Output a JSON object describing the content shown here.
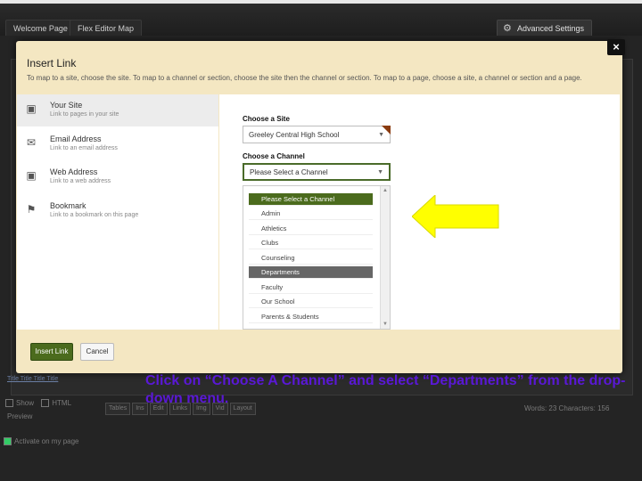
{
  "header": {
    "tabs": [
      "Welcome Page",
      "Flex Editor Map"
    ],
    "advanced_settings": "Advanced Settings"
  },
  "background_page": {
    "link_text": "Title Title Title Title",
    "toolbar": [
      "Tables",
      "Ins",
      "Edit",
      "Links",
      "Img",
      "Vid",
      "Layout"
    ],
    "checkbox1": "Show",
    "checkbox1b": "HTML",
    "preview": "Preview",
    "counter": "Words: 23 Characters: 156",
    "activate": "Activate on my page"
  },
  "dialog": {
    "title": "Insert Link",
    "instructions": "To map to a site, choose the site. To map to a channel or section, choose the site then the channel or section. To map to a page, choose a site, a channel or section and a page.",
    "close": "×",
    "options": [
      {
        "title": "Your Site",
        "desc": "Link to pages in your site"
      },
      {
        "title": "Email Address",
        "desc": "Link to an email address"
      },
      {
        "title": "Web Address",
        "desc": "Link to a web address"
      },
      {
        "title": "Bookmark",
        "desc": "Link to a bookmark on this page"
      }
    ],
    "site_label": "Choose a Site",
    "site_value": "Greeley Central High School",
    "channel_label": "Choose a Channel",
    "channel_value": "Please Select a Channel",
    "dropdown_items": [
      "Please Select a Channel",
      "Admin",
      "Athletics",
      "Clubs",
      "Counseling",
      "Departments",
      "Faculty",
      "Our School",
      "Parents & Students"
    ],
    "insert_button": "Insert Link",
    "cancel_button": "Cancel"
  },
  "annotation": {
    "text": "Click on “Choose A Channel” and select “Departments” from the drop-down menu.",
    "color": "#5a18d6"
  },
  "colors": {
    "accent_green": "#4b6b1d",
    "highlight_gray": "#666666",
    "arrow_yellow": "#ffff00",
    "dialog_bg": "#f4e7c2"
  }
}
